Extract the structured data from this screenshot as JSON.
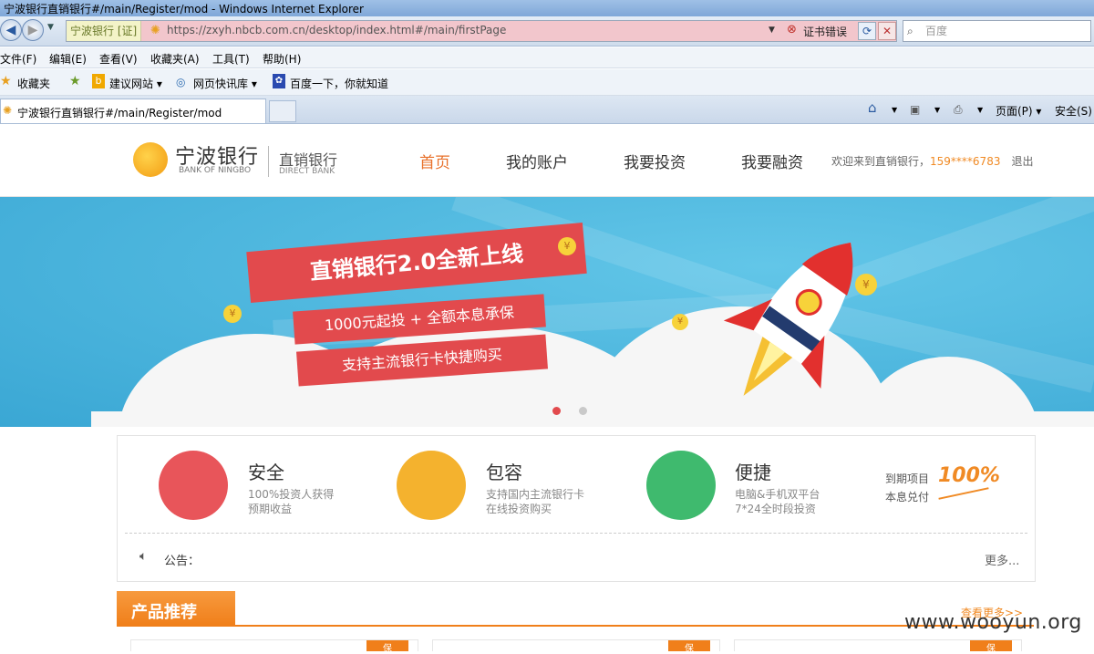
{
  "window": {
    "title": "宁波银行直销银行#/main/Register/mod - Windows Internet Explorer"
  },
  "address_bar": {
    "cert_label": "宁波银行 [证]",
    "url": "https://zxyh.nbcb.com.cn/desktop/index.html#/main/firstPage",
    "cert_error": "证书错误",
    "search_placeholder": "百度"
  },
  "menu": {
    "items": [
      "文件(F)",
      "编辑(E)",
      "查看(V)",
      "收藏夹(A)",
      "工具(T)",
      "帮助(H)"
    ]
  },
  "favorites": {
    "label": "收藏夹",
    "items": [
      "建议网站 ▾",
      "网页快讯库 ▾",
      "百度一下，你就知道"
    ]
  },
  "tabs": {
    "active_label": "宁波银行直销银行#/main/Register/mod"
  },
  "commandbar": {
    "page_label": "页面(P) ▾",
    "safety_label": "安全(S)"
  },
  "site": {
    "logo_cn": "宁波银行",
    "logo_en": "BANK OF NINGBO",
    "direct_cn": "直销银行",
    "direct_en": "DIRECT BANK",
    "nav": [
      "首页",
      "我的账户",
      "我要投资",
      "我要融资"
    ],
    "welcome_prefix": "欢迎来到直销银行，",
    "phone": "159****6783",
    "logout": "退出"
  },
  "banner": {
    "headline": "直销银行2.0全新上线",
    "line1": "1000元起投 + 全额本息承保",
    "line2": "支持主流银行卡快捷购买",
    "coin_symbol": "¥"
  },
  "features": {
    "items": [
      {
        "title": "安全",
        "desc1": "100%投资人获得",
        "desc2": "预期收益",
        "color": "#e8555a"
      },
      {
        "title": "包容",
        "desc1": "支持国内主流银行卡",
        "desc2": "在线投资购买",
        "color": "#f4b22e"
      },
      {
        "title": "便捷",
        "desc1": "电脑&手机双平台",
        "desc2": "7*24全时段投资",
        "color": "#3fba6e"
      }
    ],
    "guarantee_line1": "到期项目",
    "guarantee_line2": "本息兑付",
    "guarantee_value": "100%",
    "notice_label": "公告：",
    "more": "更多..."
  },
  "products": {
    "title": "产品推荐",
    "more": "查看更多>>",
    "tag": "保"
  },
  "watermark": "www.wooyun.org"
}
